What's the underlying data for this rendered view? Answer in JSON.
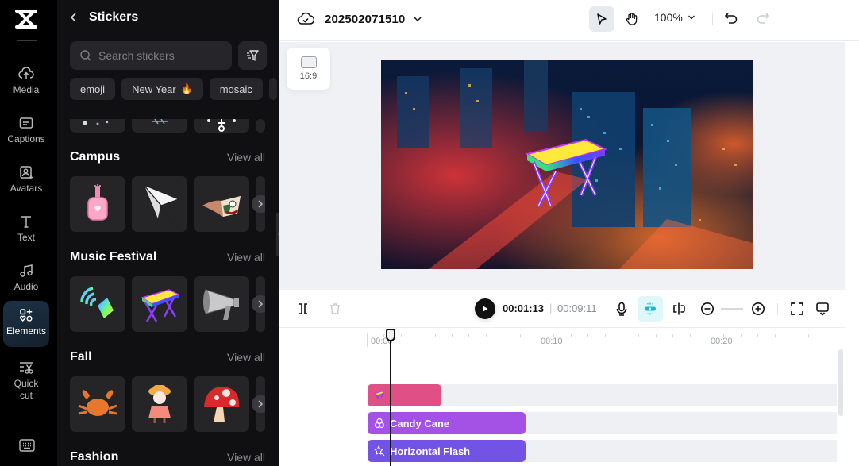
{
  "rail": {
    "items": [
      {
        "label": "Media",
        "icon": "cloud-upload-icon"
      },
      {
        "label": "Captions",
        "icon": "captions-icon"
      },
      {
        "label": "Avatars",
        "icon": "avatar-icon"
      },
      {
        "label": "Text",
        "icon": "text-icon"
      },
      {
        "label": "Audio",
        "icon": "music-note-icon"
      },
      {
        "label": "Elements",
        "icon": "elements-icon",
        "active": true
      },
      {
        "label": "Quick cut",
        "icon": "quick-cut-icon"
      }
    ],
    "bottom_icon": "keyboard-icon"
  },
  "panel": {
    "title": "Stickers",
    "search_placeholder": "Search stickers",
    "search_value": "",
    "chips": [
      {
        "label": "emoji"
      },
      {
        "label": "New Year",
        "badge": "🔥"
      },
      {
        "label": "mosaic"
      }
    ],
    "sections": [
      {
        "title": "Campus",
        "view_all": "View all",
        "stickers": [
          "nail-polish-sticker",
          "paper-plane-sticker",
          "flying-book-sticker"
        ]
      },
      {
        "title": "Music Festival",
        "view_all": "View all",
        "stickers": [
          "rainbow-speaker-sticker",
          "neon-keyboard-sticker",
          "megaphone-sticker"
        ]
      },
      {
        "title": "Fall",
        "view_all": "View all",
        "stickers": [
          "crab-sticker",
          "girl-with-hat-sticker",
          "mushroom-sticker"
        ]
      },
      {
        "title": "Fashion",
        "view_all": "View all",
        "stickers": []
      }
    ]
  },
  "topbar": {
    "project_name": "202502071510",
    "zoom": "100%"
  },
  "canvas": {
    "aspect_ratio": "16:9"
  },
  "timeline": {
    "current_time": "00:01:13",
    "separator": "|",
    "total_time": "00:09:11",
    "ruler_labels": [
      "00:00",
      "00:10",
      "00:20"
    ],
    "tracks": [
      {
        "type": "sticker",
        "label": "",
        "color": "#e04f86"
      },
      {
        "type": "effect",
        "label": "Candy Cane",
        "color": "#a452e6"
      },
      {
        "type": "effect",
        "label": "Horizontal Flash",
        "color": "#7253e5"
      }
    ]
  }
}
